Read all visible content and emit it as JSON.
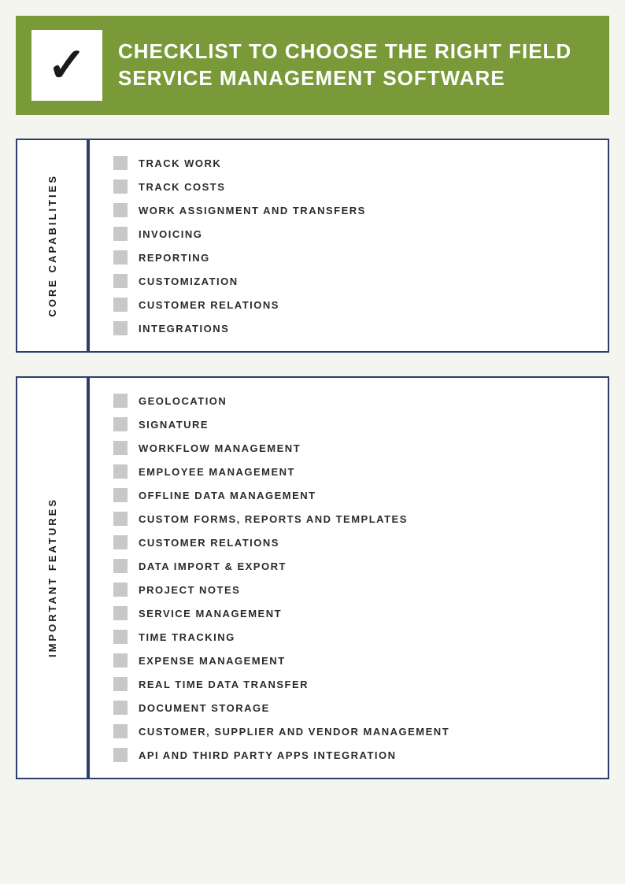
{
  "header": {
    "title": "CHECKLIST TO CHOOSE THE RIGHT FIELD SERVICE MANAGEMENT SOFTWARE",
    "checkmark": "✓"
  },
  "sections": [
    {
      "id": "core-capabilities",
      "label": "CORE CAPABILITIES",
      "items": [
        "TRACK WORK",
        "TRACK COSTS",
        "WORK ASSIGNMENT AND TRANSFERS",
        "INVOICING",
        "REPORTING",
        "CUSTOMIZATION",
        "CUSTOMER RELATIONS",
        "INTEGRATIONS"
      ]
    },
    {
      "id": "important-features",
      "label": "IMPORTANT FEATURES",
      "items": [
        "GEOLOCATION",
        "SIGNATURE",
        "WORKFLOW MANAGEMENT",
        "EMPLOYEE MANAGEMENT",
        "OFFLINE DATA MANAGEMENT",
        "CUSTOM FORMS, REPORTS AND TEMPLATES",
        "CUSTOMER RELATIONS",
        "DATA IMPORT & EXPORT",
        "PROJECT NOTES",
        "SERVICE MANAGEMENT",
        "TIME TRACKING",
        "EXPENSE MANAGEMENT",
        "REAL TIME DATA TRANSFER",
        "DOCUMENT STORAGE",
        "CUSTOMER, SUPPLIER AND VENDOR MANAGEMENT",
        "API AND THIRD PARTY APPS INTEGRATION"
      ]
    }
  ]
}
